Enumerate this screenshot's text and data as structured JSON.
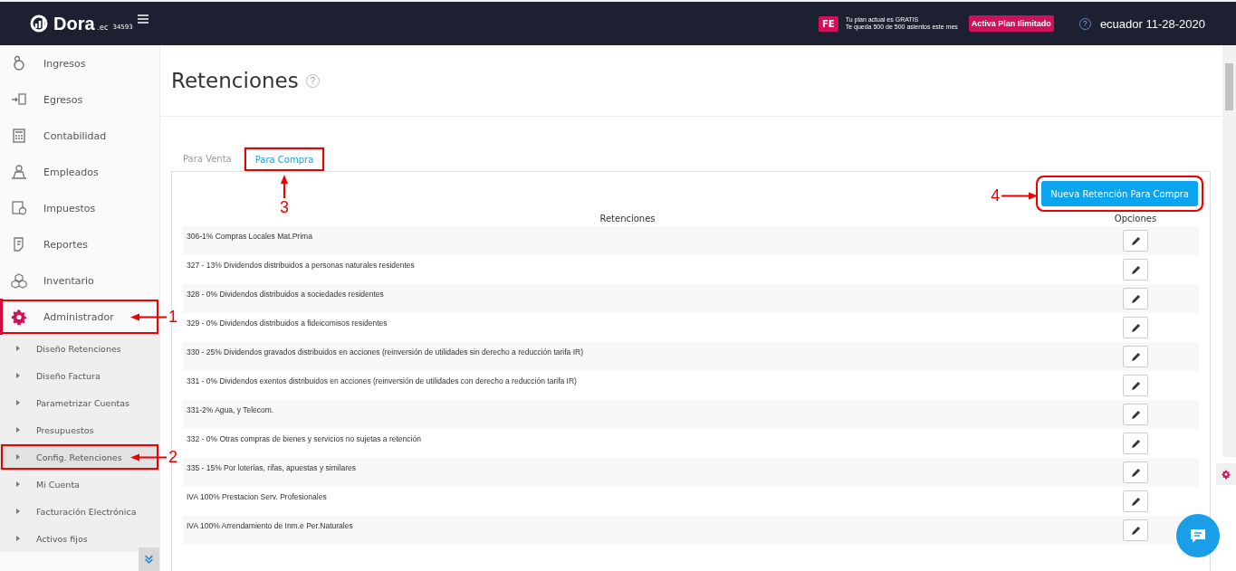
{
  "header": {
    "logo": "Dora",
    "logo_suffix": ".ec",
    "account": "34593",
    "plan_badge": "FE",
    "plan_lines": [
      "Tu plan actual es GRATIS",
      "Te queda 500 de 500 asientos este mes"
    ],
    "upgrade_button": "Activa Plan Ilimitado",
    "region_date": "ecuador 11-28-2020",
    "help": "?"
  },
  "sidebar": {
    "items": [
      {
        "label": "Ingresos",
        "selected": false
      },
      {
        "label": "Egresos",
        "selected": false
      },
      {
        "label": "Contabilidad",
        "selected": false
      },
      {
        "label": "Empleados",
        "selected": false
      },
      {
        "label": "Impuestos",
        "selected": false
      },
      {
        "label": "Reportes",
        "selected": false
      },
      {
        "label": "Inventario",
        "selected": false
      },
      {
        "label": "Administrador",
        "selected": true,
        "callout": "1"
      }
    ],
    "subitems": [
      {
        "label": "Diseño Retenciones",
        "selected": false
      },
      {
        "label": "Diseño Factura",
        "selected": false
      },
      {
        "label": "Parametrizar Cuentas",
        "selected": false
      },
      {
        "label": "Presupuestos",
        "selected": false
      },
      {
        "label": "Config. Retenciones",
        "selected": true,
        "callout": "2"
      },
      {
        "label": "Mi Cuenta",
        "selected": false
      },
      {
        "label": "Facturación Electrónica",
        "selected": false
      },
      {
        "label": "Activos fijos",
        "selected": false
      }
    ]
  },
  "page": {
    "title": "Retenciones",
    "help": "?",
    "tabs": [
      {
        "label": "Para Venta",
        "selected": false
      },
      {
        "label": "Para Compra",
        "selected": true,
        "callout": "3"
      }
    ],
    "new_button": {
      "label": "Nueva Retención Para Compra",
      "callout": "4"
    },
    "table": {
      "columns": [
        "Retenciones",
        "Opciones"
      ],
      "rows": [
        "306-1% Compras Locales Mat.Prima",
        "327 - 13% Dividendos distribuidos a personas naturales residentes",
        "328 - 0% Dividendos distribuidos a sociedades residentes",
        "329 - 0% Dividendos distribuidos a fideicomisos residentes",
        "330 - 25% Dividendos gravados distribuidos en acciones (reinversión de utilidades sin derecho a reducción tarifa IR)",
        "331 - 0% Dividendos exentos distribuidos en acciones (reinversión de utilidades con derecho a reducción tarifa IR)",
        "331-2% Agua, y Telecom.",
        "332 - 0% Otras compras de bienes y servicios no sujetas a retención",
        "335 - 15% Por loterías, rifas, apuestas y similares",
        "IVA 100% Prestacion Serv. Profesionales",
        "IVA 100% Arrendamiento de Inm.e Per.Naturales"
      ]
    }
  }
}
